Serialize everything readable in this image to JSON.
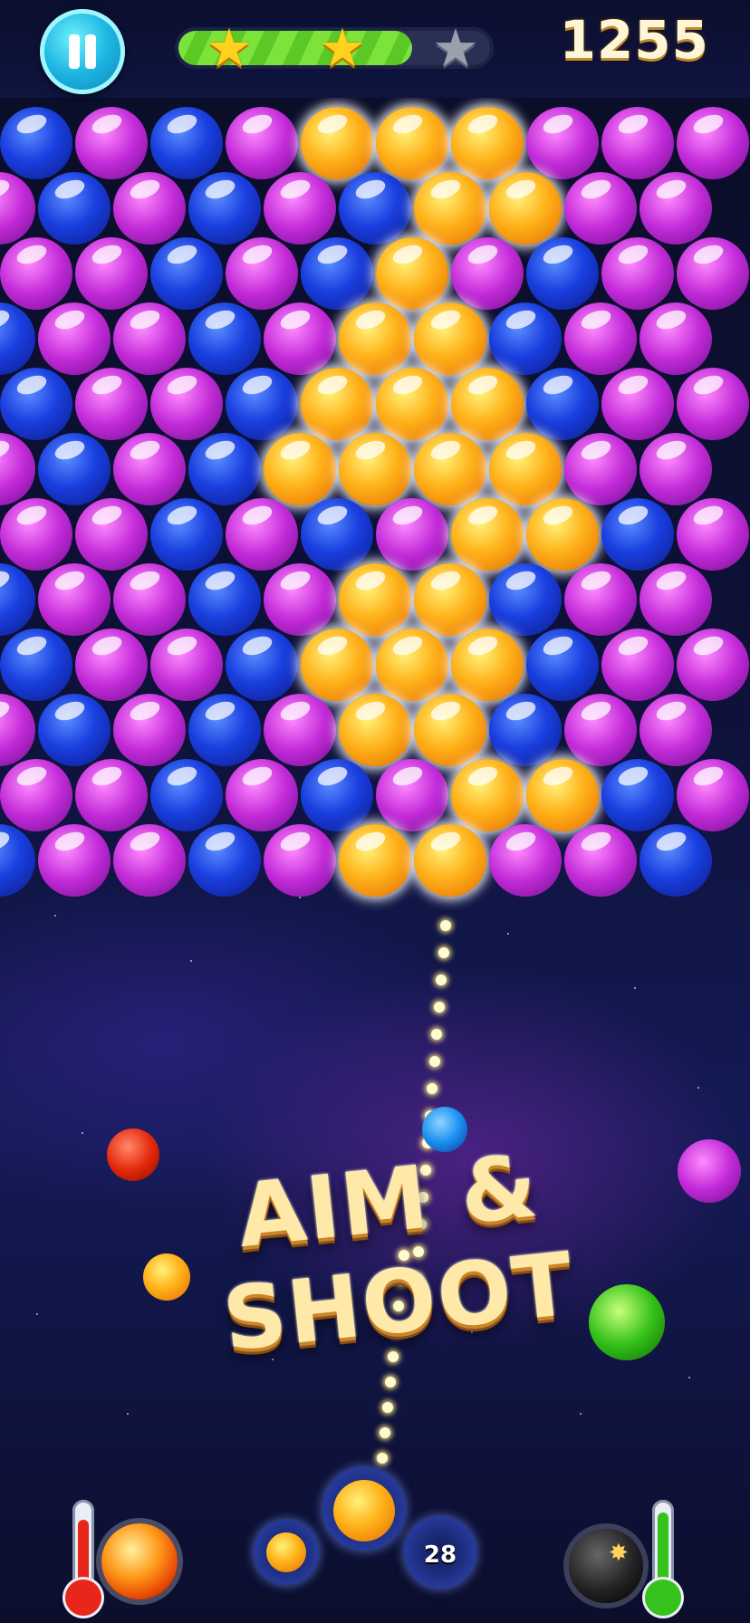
{
  "hud": {
    "score": "1255",
    "progress_fraction": 0.75,
    "stars_earned": 2,
    "stars_total": 3
  },
  "game": {
    "banner_text": "AIM & SHOOT",
    "moves_left": "28",
    "current_ball_color": "orange",
    "next_ball_color": "orange"
  },
  "colors": {
    "blue": "#1a3fe0",
    "purple": "#c22ad8",
    "orange": "#ffb21a",
    "progress_green": "#7be33a",
    "star_gold": "#ffd21e"
  },
  "grid": {
    "rows": [
      "bpbpoooppp",
      "pbpbpbooppb",
      "ppbpbopbppb",
      "bppbpoobppb",
      "bppbooobppp",
      "pbpbooooppb",
      "ppbpbpoobppb",
      "bppbpoobppb",
      "bppbooobppp",
      "pbpbpoobppb",
      "ppbpbpoobppb",
      "bppbpooppbp"
    ]
  },
  "icons": {
    "pause": "pause-icon",
    "fireball": "fireball-booster-icon",
    "bomb": "bomb-booster-icon"
  }
}
